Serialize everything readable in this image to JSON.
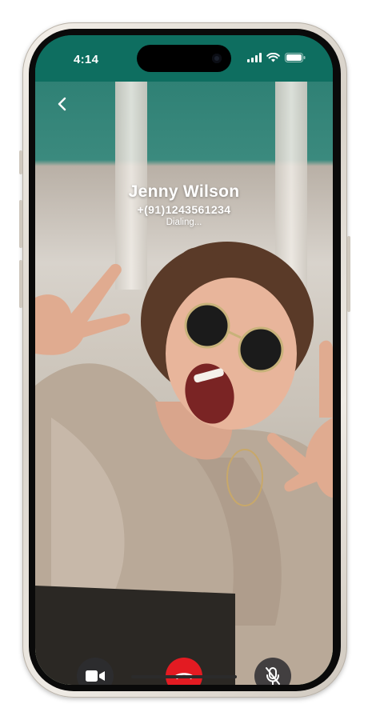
{
  "status_bar": {
    "time": "4:14"
  },
  "call": {
    "name": "Jenny Wilson",
    "phone": "+(91)1243561234",
    "status": "Dialing..."
  },
  "icons": {
    "back": "chevron-left-icon",
    "video": "video-camera-icon",
    "end_call": "phone-hangup-icon",
    "mute": "microphone-off-icon"
  },
  "colors": {
    "status_bar_bg": "#0e6e60",
    "end_call": "#e31b22",
    "control_bg": "#2d2d30"
  }
}
